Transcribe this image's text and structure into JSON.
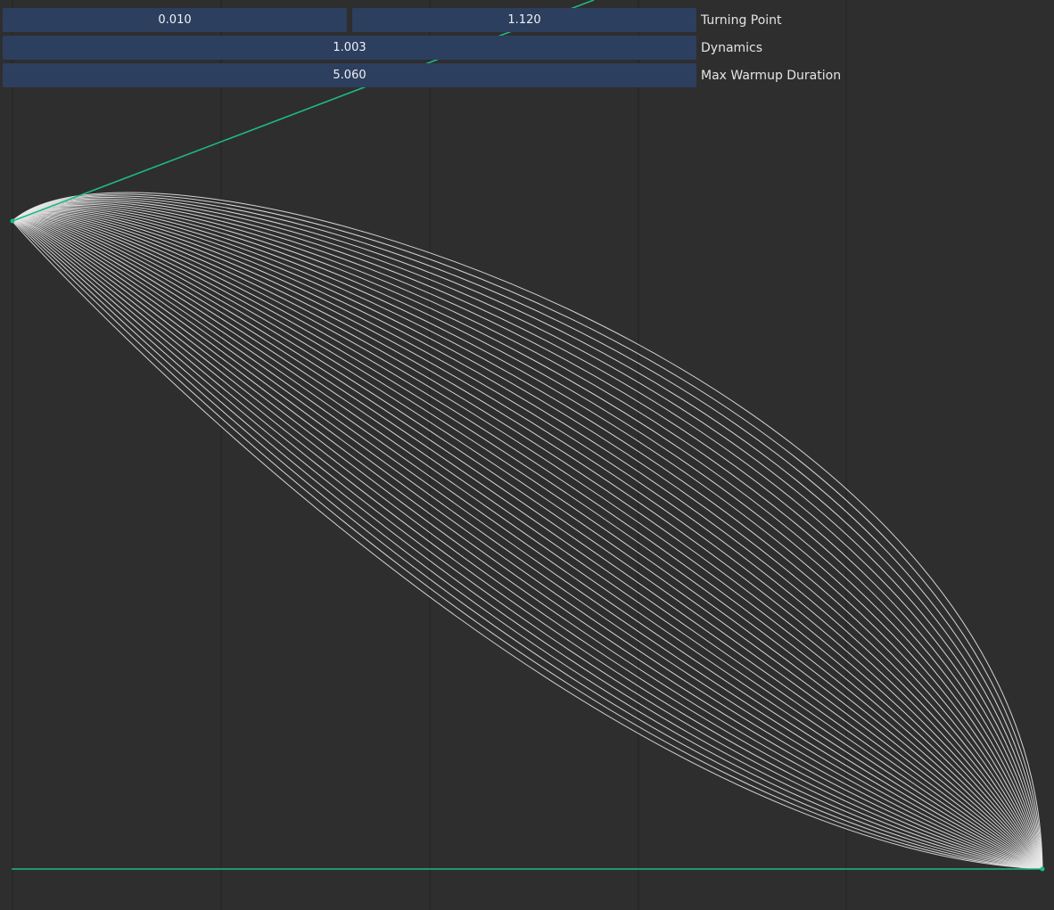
{
  "controls": {
    "turning_point": {
      "label": "Turning Point",
      "value_min": "0.010",
      "value_max": "1.120"
    },
    "dynamics": {
      "label": "Dynamics",
      "value": "1.003"
    },
    "max_warmup_duration": {
      "label": "Max Warmup Duration",
      "value": "5.060"
    }
  },
  "chart_data": {
    "type": "line",
    "curve_family_count": 42,
    "grid": "vertical lines only",
    "colors": {
      "background": "#2e2e2e",
      "curves": "#e8e8e8",
      "guides": "#1fb886",
      "gridlines": "#252525"
    }
  }
}
